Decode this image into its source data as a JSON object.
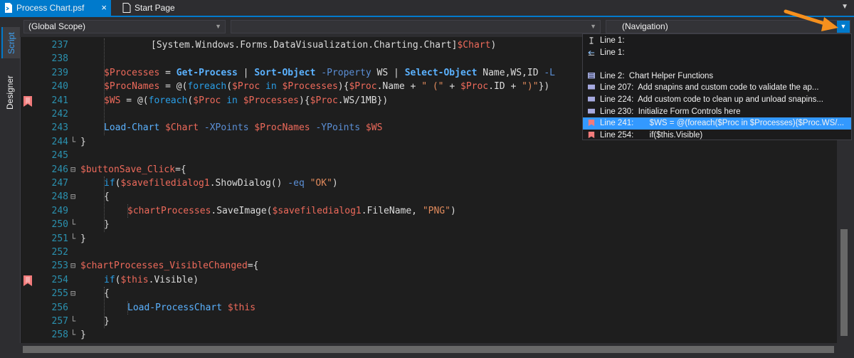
{
  "tabs": [
    {
      "label": "Process Chart.psf",
      "close": "×",
      "icon": "powershell-file-icon"
    },
    {
      "label": "Start Page",
      "icon": "page-icon"
    }
  ],
  "scope": {
    "value": "(Global Scope)"
  },
  "middle_combo": {
    "value": ""
  },
  "navigation": {
    "value": "(Navigation)"
  },
  "side_tabs": [
    "Script",
    "Designer"
  ],
  "colors": {
    "accent": "#007acc",
    "variable": "#ee6a5b",
    "cmdlet": "#5bb2ff",
    "string": "#e08a5c",
    "bookmark": "#f27b7b",
    "selection": "#3399ff"
  },
  "code_lines": [
    {
      "n": "237",
      "bookmark": false,
      "fold": "",
      "indent": 3,
      "tokens": [
        [
          "t-type",
          "[System.Windows.Forms.DataVisualization.Charting.Chart]"
        ],
        [
          "t-var",
          "$Chart"
        ],
        [
          "t-plain",
          ")"
        ]
      ]
    },
    {
      "n": "238",
      "bookmark": false,
      "fold": "",
      "indent": 0,
      "tokens": []
    },
    {
      "n": "239",
      "bookmark": false,
      "fold": "",
      "indent": 1,
      "tokens": [
        [
          "t-var",
          "$Processes"
        ],
        [
          "t-plain",
          " = "
        ],
        [
          "t-cmdb",
          "Get-Process"
        ],
        [
          "t-plain",
          " | "
        ],
        [
          "t-cmdb",
          "Sort-Object"
        ],
        [
          "t-plain",
          " "
        ],
        [
          "t-param",
          "-Property"
        ],
        [
          "t-plain",
          " WS | "
        ],
        [
          "t-cmdb",
          "Select-Object"
        ],
        [
          "t-plain",
          " Name,WS,ID "
        ],
        [
          "t-param",
          "-L"
        ]
      ]
    },
    {
      "n": "240",
      "bookmark": false,
      "fold": "",
      "indent": 1,
      "tokens": [
        [
          "t-var",
          "$ProcNames"
        ],
        [
          "t-plain",
          " = @("
        ],
        [
          "t-kw",
          "foreach"
        ],
        [
          "t-plain",
          "("
        ],
        [
          "t-var",
          "$Proc"
        ],
        [
          "t-plain",
          " "
        ],
        [
          "t-kw",
          "in"
        ],
        [
          "t-plain",
          " "
        ],
        [
          "t-var",
          "$Processes"
        ],
        [
          "t-plain",
          "){"
        ],
        [
          "t-var",
          "$Proc"
        ],
        [
          "t-plain",
          ".Name + "
        ],
        [
          "t-str",
          "\" (\""
        ],
        [
          "t-plain",
          " + "
        ],
        [
          "t-var",
          "$Proc"
        ],
        [
          "t-plain",
          ".ID + "
        ],
        [
          "t-str",
          "\")\""
        ],
        [
          "t-plain",
          "})"
        ]
      ]
    },
    {
      "n": "241",
      "bookmark": true,
      "fold": "",
      "indent": 1,
      "tokens": [
        [
          "t-var",
          "$WS"
        ],
        [
          "t-plain",
          " = @("
        ],
        [
          "t-kw",
          "foreach"
        ],
        [
          "t-plain",
          "("
        ],
        [
          "t-var",
          "$Proc"
        ],
        [
          "t-plain",
          " "
        ],
        [
          "t-kw",
          "in"
        ],
        [
          "t-plain",
          " "
        ],
        [
          "t-var",
          "$Processes"
        ],
        [
          "t-plain",
          "){"
        ],
        [
          "t-var",
          "$Proc"
        ],
        [
          "t-plain",
          ".WS/1MB})"
        ]
      ]
    },
    {
      "n": "242",
      "bookmark": false,
      "fold": "",
      "indent": 0,
      "tokens": []
    },
    {
      "n": "243",
      "bookmark": false,
      "fold": "",
      "indent": 1,
      "tokens": [
        [
          "t-cmd",
          "Load-Chart"
        ],
        [
          "t-plain",
          " "
        ],
        [
          "t-var",
          "$Chart"
        ],
        [
          "t-plain",
          " "
        ],
        [
          "t-param",
          "-XPoints"
        ],
        [
          "t-plain",
          " "
        ],
        [
          "t-var",
          "$ProcNames"
        ],
        [
          "t-plain",
          " "
        ],
        [
          "t-param",
          "-YPoints"
        ],
        [
          "t-plain",
          " "
        ],
        [
          "t-var",
          "$WS"
        ]
      ]
    },
    {
      "n": "244",
      "bookmark": false,
      "fold": "end",
      "indent": 0,
      "tokens": [
        [
          "t-plain",
          "}"
        ]
      ]
    },
    {
      "n": "245",
      "bookmark": false,
      "fold": "",
      "indent": 0,
      "tokens": []
    },
    {
      "n": "246",
      "bookmark": false,
      "fold": "open",
      "indent": 0,
      "tokens": [
        [
          "t-var",
          "$buttonSave_Click"
        ],
        [
          "t-plain",
          "={"
        ]
      ]
    },
    {
      "n": "247",
      "bookmark": false,
      "fold": "",
      "indent": 1,
      "tokens": [
        [
          "t-kw",
          "if"
        ],
        [
          "t-plain",
          "("
        ],
        [
          "t-var",
          "$savefiledialog1"
        ],
        [
          "t-plain",
          ".ShowDialog() "
        ],
        [
          "t-param",
          "-eq"
        ],
        [
          "t-plain",
          " "
        ],
        [
          "t-str",
          "\"OK\""
        ],
        [
          "t-plain",
          ")"
        ]
      ]
    },
    {
      "n": "248",
      "bookmark": false,
      "fold": "open",
      "indent": 1,
      "tokens": [
        [
          "t-plain",
          "{"
        ]
      ]
    },
    {
      "n": "249",
      "bookmark": false,
      "fold": "",
      "indent": 2,
      "tokens": [
        [
          "t-var",
          "$chartProcesses"
        ],
        [
          "t-plain",
          ".SaveImage("
        ],
        [
          "t-var",
          "$savefiledialog1"
        ],
        [
          "t-plain",
          ".FileName, "
        ],
        [
          "t-str",
          "\"PNG\""
        ],
        [
          "t-plain",
          ")"
        ]
      ]
    },
    {
      "n": "250",
      "bookmark": false,
      "fold": "end",
      "indent": 1,
      "tokens": [
        [
          "t-plain",
          "}"
        ]
      ]
    },
    {
      "n": "251",
      "bookmark": false,
      "fold": "end",
      "indent": 0,
      "tokens": [
        [
          "t-plain",
          "}"
        ]
      ]
    },
    {
      "n": "252",
      "bookmark": false,
      "fold": "",
      "indent": 0,
      "tokens": []
    },
    {
      "n": "253",
      "bookmark": false,
      "fold": "open",
      "indent": 0,
      "tokens": [
        [
          "t-var",
          "$chartProcesses_VisibleChanged"
        ],
        [
          "t-plain",
          "={"
        ]
      ]
    },
    {
      "n": "254",
      "bookmark": true,
      "fold": "",
      "indent": 1,
      "tokens": [
        [
          "t-kw",
          "if"
        ],
        [
          "t-plain",
          "("
        ],
        [
          "t-var",
          "$this"
        ],
        [
          "t-plain",
          ".Visible)"
        ]
      ]
    },
    {
      "n": "255",
      "bookmark": false,
      "fold": "open",
      "indent": 1,
      "tokens": [
        [
          "t-plain",
          "{"
        ]
      ]
    },
    {
      "n": "256",
      "bookmark": false,
      "fold": "",
      "indent": 2,
      "tokens": [
        [
          "t-cmd",
          "Load-ProcessChart"
        ],
        [
          "t-plain",
          " "
        ],
        [
          "t-var",
          "$this"
        ]
      ]
    },
    {
      "n": "257",
      "bookmark": false,
      "fold": "end",
      "indent": 1,
      "tokens": [
        [
          "t-plain",
          "}"
        ]
      ]
    },
    {
      "n": "258",
      "bookmark": false,
      "fold": "end",
      "indent": 0,
      "tokens": [
        [
          "t-plain",
          "}"
        ]
      ]
    }
  ],
  "nav_items": [
    {
      "icon": "text-cursor-icon",
      "text": "Line 1:",
      "selected": false
    },
    {
      "icon": "edit-arrow-icon",
      "text": "Line 1:",
      "selected": false
    },
    {
      "icon": "",
      "text": "",
      "selected": false
    },
    {
      "icon": "region-icon",
      "text": "Line 2:  Chart Helper Functions",
      "selected": false
    },
    {
      "icon": "comment-block-icon",
      "text": "Line 207:  Add snapins and custom code to validate the ap...",
      "selected": false
    },
    {
      "icon": "comment-block-icon",
      "text": "Line 224:  Add custom code to clean up and unload snapins...",
      "selected": false
    },
    {
      "icon": "comment-block-icon",
      "text": "Line 230:  Initialize Form Controls here",
      "selected": false
    },
    {
      "icon": "bookmark-icon",
      "text": "Line 241:       $WS = @(foreach($Proc in $Processes){$Proc.WS/...",
      "selected": true
    },
    {
      "icon": "bookmark-icon",
      "text": "Line 254:       if($this.Visible)",
      "selected": false
    }
  ]
}
